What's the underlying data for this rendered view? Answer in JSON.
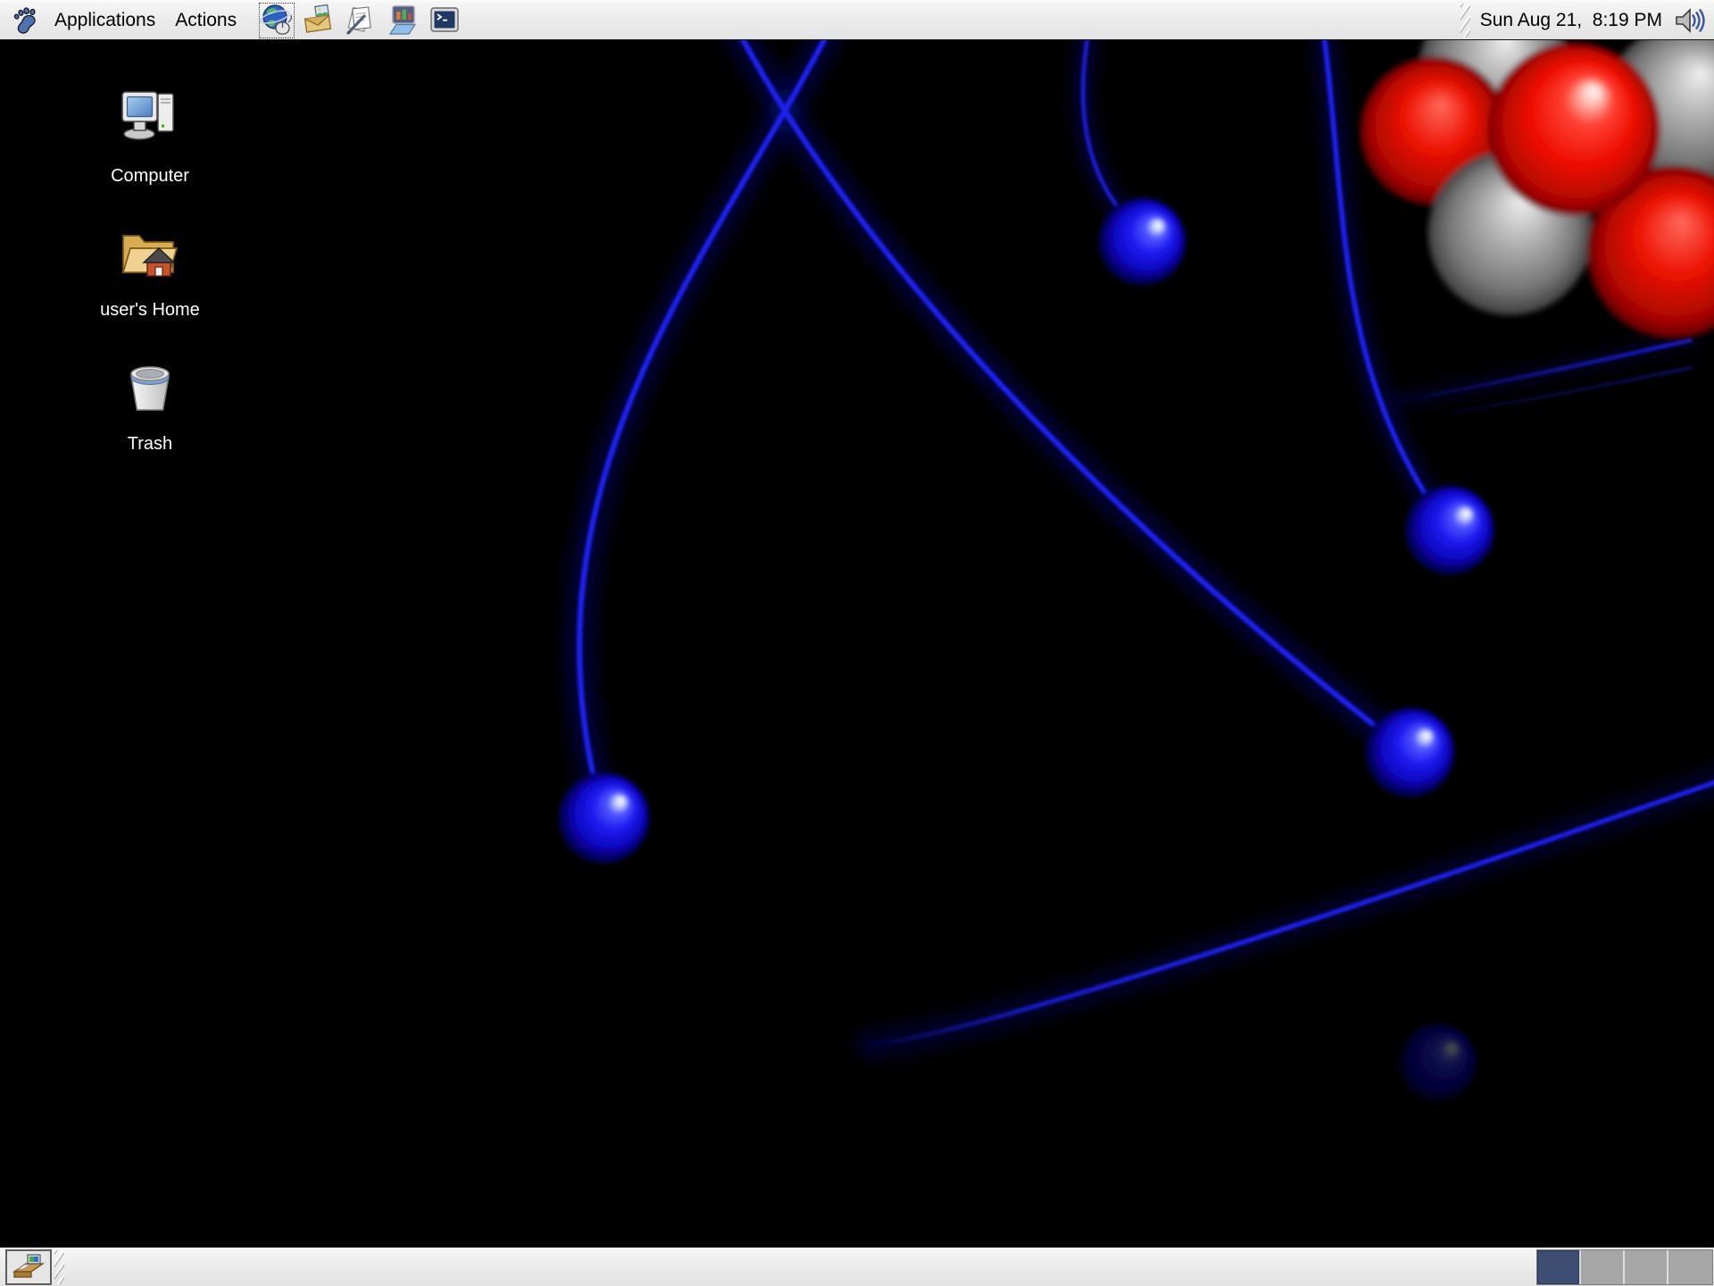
{
  "top_panel": {
    "menus": [
      {
        "label": "Applications"
      },
      {
        "label": "Actions"
      }
    ],
    "launchers": [
      {
        "name": "web-browser"
      },
      {
        "name": "email"
      },
      {
        "name": "word-processor"
      },
      {
        "name": "presentation"
      },
      {
        "name": "terminal"
      }
    ],
    "clock": "Sun Aug 21,  8:19 PM"
  },
  "desktop": {
    "icons": [
      {
        "label": "Computer"
      },
      {
        "label": "user's Home"
      },
      {
        "label": "Trash"
      }
    ],
    "wallpaper": {
      "style": "atom-orbitals",
      "background": "#000000",
      "orbit_color": "#1c22f2",
      "electron_color": "#1f1af0",
      "electron_count": 4,
      "nucleus_colors": [
        "#ee0d00",
        "#a8a8a8"
      ]
    }
  },
  "bottom_panel": {
    "workspaces": {
      "count": 4,
      "active": 1
    }
  },
  "colors": {
    "panel_bg": "#ececec",
    "panel_border": "#161616",
    "active_workspace": "#3e4e73",
    "inactive_workspace": "#a6a6a6",
    "menu_text": "#000000",
    "icon_label_text": "#ffffff"
  }
}
